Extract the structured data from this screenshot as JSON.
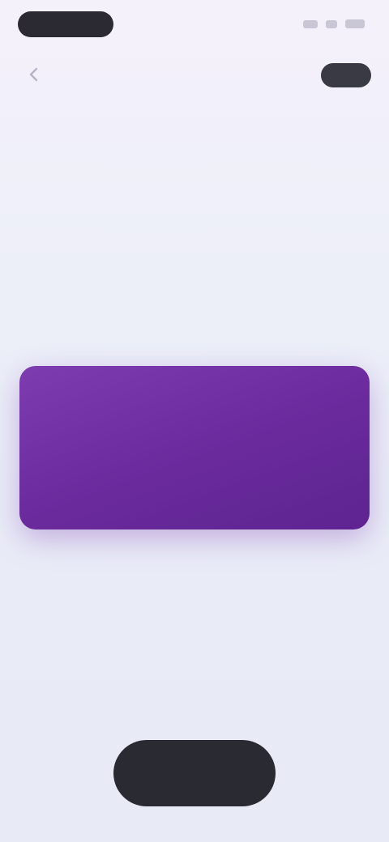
{
  "nav": {
    "title": "",
    "action_label": ""
  },
  "header": {
    "headline": "",
    "subhead": ""
  },
  "info": {
    "label": "",
    "value": "",
    "caption": ""
  },
  "promo": {
    "line": "",
    "sub": "",
    "link": ""
  },
  "cta": {
    "label": ""
  },
  "colors": {
    "accent": "#6a2a9c",
    "cta": "#2a2a32",
    "background": "#eceff8"
  },
  "icons": {
    "back": "chevron-left-icon",
    "signal": "signal-icon",
    "wifi": "wifi-icon",
    "battery": "battery-icon"
  }
}
